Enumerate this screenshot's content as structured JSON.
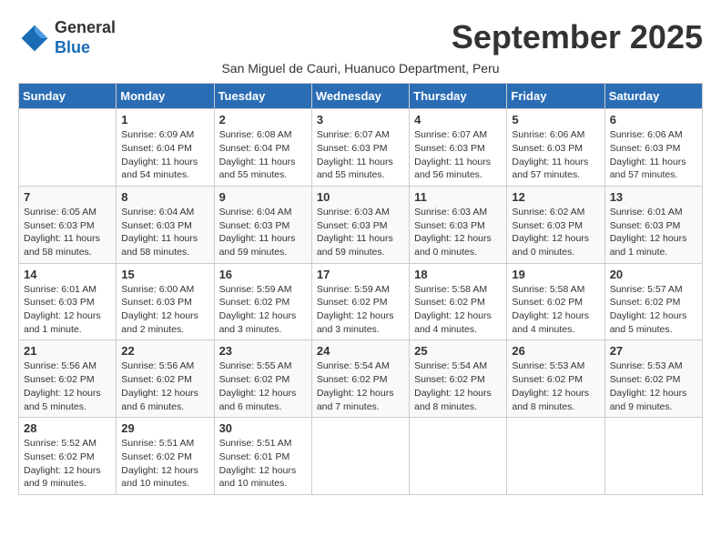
{
  "header": {
    "logo_line1": "General",
    "logo_line2": "Blue",
    "month_title": "September 2025",
    "subtitle": "San Miguel de Cauri, Huanuco Department, Peru"
  },
  "weekdays": [
    "Sunday",
    "Monday",
    "Tuesday",
    "Wednesday",
    "Thursday",
    "Friday",
    "Saturday"
  ],
  "weeks": [
    [
      {
        "day": "",
        "info": ""
      },
      {
        "day": "1",
        "info": "Sunrise: 6:09 AM\nSunset: 6:04 PM\nDaylight: 11 hours\nand 54 minutes."
      },
      {
        "day": "2",
        "info": "Sunrise: 6:08 AM\nSunset: 6:04 PM\nDaylight: 11 hours\nand 55 minutes."
      },
      {
        "day": "3",
        "info": "Sunrise: 6:07 AM\nSunset: 6:03 PM\nDaylight: 11 hours\nand 55 minutes."
      },
      {
        "day": "4",
        "info": "Sunrise: 6:07 AM\nSunset: 6:03 PM\nDaylight: 11 hours\nand 56 minutes."
      },
      {
        "day": "5",
        "info": "Sunrise: 6:06 AM\nSunset: 6:03 PM\nDaylight: 11 hours\nand 57 minutes."
      },
      {
        "day": "6",
        "info": "Sunrise: 6:06 AM\nSunset: 6:03 PM\nDaylight: 11 hours\nand 57 minutes."
      }
    ],
    [
      {
        "day": "7",
        "info": "Sunrise: 6:05 AM\nSunset: 6:03 PM\nDaylight: 11 hours\nand 58 minutes."
      },
      {
        "day": "8",
        "info": "Sunrise: 6:04 AM\nSunset: 6:03 PM\nDaylight: 11 hours\nand 58 minutes."
      },
      {
        "day": "9",
        "info": "Sunrise: 6:04 AM\nSunset: 6:03 PM\nDaylight: 11 hours\nand 59 minutes."
      },
      {
        "day": "10",
        "info": "Sunrise: 6:03 AM\nSunset: 6:03 PM\nDaylight: 11 hours\nand 59 minutes."
      },
      {
        "day": "11",
        "info": "Sunrise: 6:03 AM\nSunset: 6:03 PM\nDaylight: 12 hours\nand 0 minutes."
      },
      {
        "day": "12",
        "info": "Sunrise: 6:02 AM\nSunset: 6:03 PM\nDaylight: 12 hours\nand 0 minutes."
      },
      {
        "day": "13",
        "info": "Sunrise: 6:01 AM\nSunset: 6:03 PM\nDaylight: 12 hours\nand 1 minute."
      }
    ],
    [
      {
        "day": "14",
        "info": "Sunrise: 6:01 AM\nSunset: 6:03 PM\nDaylight: 12 hours\nand 1 minute."
      },
      {
        "day": "15",
        "info": "Sunrise: 6:00 AM\nSunset: 6:03 PM\nDaylight: 12 hours\nand 2 minutes."
      },
      {
        "day": "16",
        "info": "Sunrise: 5:59 AM\nSunset: 6:02 PM\nDaylight: 12 hours\nand 3 minutes."
      },
      {
        "day": "17",
        "info": "Sunrise: 5:59 AM\nSunset: 6:02 PM\nDaylight: 12 hours\nand 3 minutes."
      },
      {
        "day": "18",
        "info": "Sunrise: 5:58 AM\nSunset: 6:02 PM\nDaylight: 12 hours\nand 4 minutes."
      },
      {
        "day": "19",
        "info": "Sunrise: 5:58 AM\nSunset: 6:02 PM\nDaylight: 12 hours\nand 4 minutes."
      },
      {
        "day": "20",
        "info": "Sunrise: 5:57 AM\nSunset: 6:02 PM\nDaylight: 12 hours\nand 5 minutes."
      }
    ],
    [
      {
        "day": "21",
        "info": "Sunrise: 5:56 AM\nSunset: 6:02 PM\nDaylight: 12 hours\nand 5 minutes."
      },
      {
        "day": "22",
        "info": "Sunrise: 5:56 AM\nSunset: 6:02 PM\nDaylight: 12 hours\nand 6 minutes."
      },
      {
        "day": "23",
        "info": "Sunrise: 5:55 AM\nSunset: 6:02 PM\nDaylight: 12 hours\nand 6 minutes."
      },
      {
        "day": "24",
        "info": "Sunrise: 5:54 AM\nSunset: 6:02 PM\nDaylight: 12 hours\nand 7 minutes."
      },
      {
        "day": "25",
        "info": "Sunrise: 5:54 AM\nSunset: 6:02 PM\nDaylight: 12 hours\nand 8 minutes."
      },
      {
        "day": "26",
        "info": "Sunrise: 5:53 AM\nSunset: 6:02 PM\nDaylight: 12 hours\nand 8 minutes."
      },
      {
        "day": "27",
        "info": "Sunrise: 5:53 AM\nSunset: 6:02 PM\nDaylight: 12 hours\nand 9 minutes."
      }
    ],
    [
      {
        "day": "28",
        "info": "Sunrise: 5:52 AM\nSunset: 6:02 PM\nDaylight: 12 hours\nand 9 minutes."
      },
      {
        "day": "29",
        "info": "Sunrise: 5:51 AM\nSunset: 6:02 PM\nDaylight: 12 hours\nand 10 minutes."
      },
      {
        "day": "30",
        "info": "Sunrise: 5:51 AM\nSunset: 6:01 PM\nDaylight: 12 hours\nand 10 minutes."
      },
      {
        "day": "",
        "info": ""
      },
      {
        "day": "",
        "info": ""
      },
      {
        "day": "",
        "info": ""
      },
      {
        "day": "",
        "info": ""
      }
    ]
  ]
}
